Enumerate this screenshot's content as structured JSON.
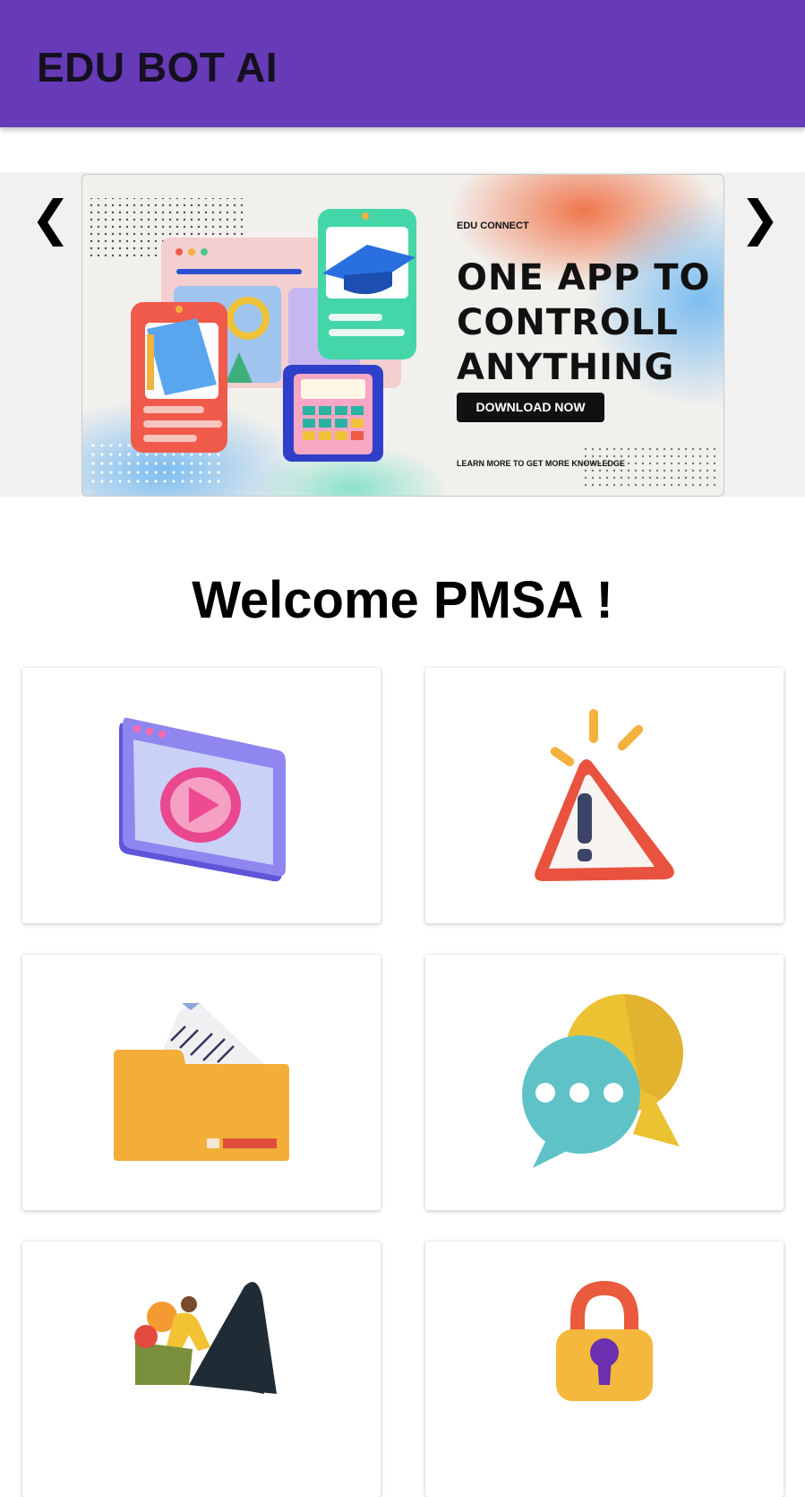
{
  "appbar": {
    "title": "EDU BOT AI",
    "color": "#673ab7"
  },
  "carousel": {
    "prev_label": "❮",
    "next_label": "❯",
    "banner": {
      "tag": "EDU CONNECT",
      "headline": "ONE APP TO CONTROLL ANYTHING",
      "button_label": "DOWNLOAD NOW",
      "footer": "LEARN MORE TO GET MORE KNOWLEDGE"
    }
  },
  "welcome": {
    "text": "Welcome PMSA !"
  },
  "menu_cards": [
    {
      "icon": "video-player-icon"
    },
    {
      "icon": "warning-icon"
    },
    {
      "icon": "folder-icon"
    },
    {
      "icon": "chat-bubbles-icon"
    },
    {
      "icon": "climbing-person-icon"
    },
    {
      "icon": "padlock-icon"
    }
  ]
}
